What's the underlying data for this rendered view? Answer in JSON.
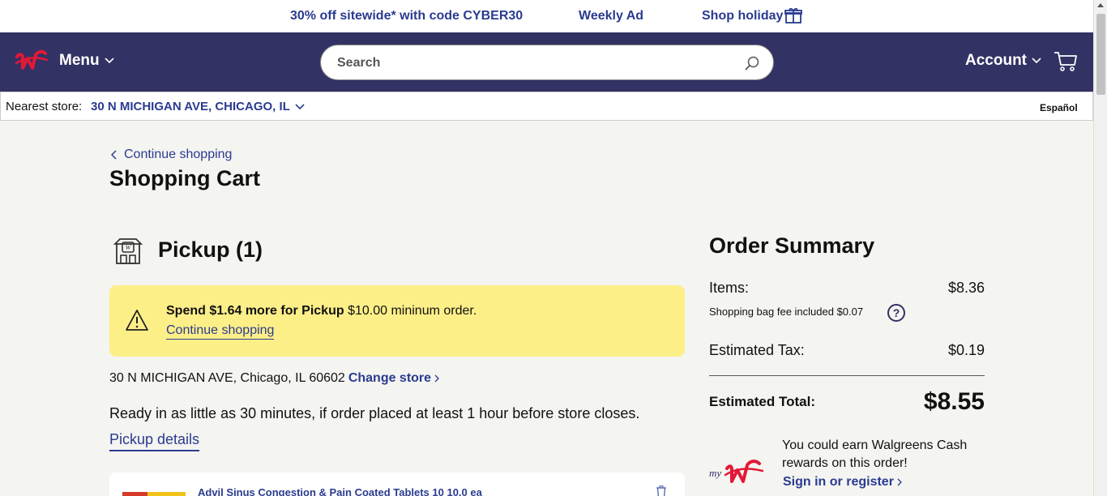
{
  "promo": {
    "deal": "30% off sitewide* with code CYBER30",
    "weekly_ad": "Weekly Ad",
    "shop_holiday": "Shop holiday"
  },
  "header": {
    "menu_label": "Menu",
    "search_placeholder": "Search",
    "account_label": "Account"
  },
  "storebar": {
    "label": "Nearest store:",
    "store": "30 N MICHIGAN AVE, CHICAGO, IL",
    "language": "Español"
  },
  "cart": {
    "continue_shopping": "Continue shopping",
    "title": "Shopping Cart",
    "pickup_title": "Pickup (1)",
    "notice": {
      "bold": "Spend $1.64 more for Pickup",
      "rest": " $10.00 mininum order.",
      "link": "Continue shopping"
    },
    "address": "30 N MICHIGAN AVE, Chicago, IL 60602",
    "change_store": "Change store",
    "ready_text": "Ready in as little as 30 minutes, if order placed at least 1 hour before store closes.",
    "pickup_details": "Pickup details",
    "item_name": "Advil Sinus Congestion & Pain Coated Tablets 10 10.0 ea"
  },
  "summary": {
    "title": "Order Summary",
    "items_label": "Items:",
    "items_value": "$8.36",
    "bag_fee": "Shopping bag fee included $0.07",
    "help": "?",
    "tax_label": "Estimated Tax:",
    "tax_value": "$0.19",
    "total_label": "Estimated Total:",
    "total_value": "$8.55",
    "rewards_text": "You could earn Walgreens Cash rewards on this order!",
    "sign_in": "Sign in or register"
  },
  "colors": {
    "brand_navy": "#323264",
    "link_blue": "#2a3b8f",
    "brand_red": "#e31837",
    "notice_yellow": "#fdef88"
  }
}
